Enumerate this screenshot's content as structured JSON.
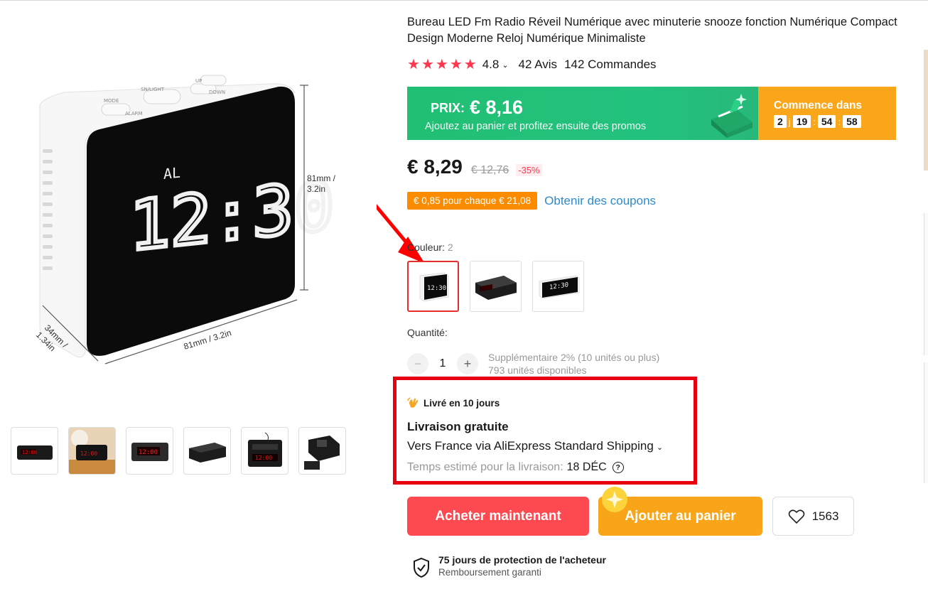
{
  "product": {
    "title": "Bureau LED Fm Radio Réveil Numérique avec minuterie snooze fonction Numérique Compact Design Moderne Reloj Numérique Minimaliste",
    "image_annotations": {
      "clock_al": "AL",
      "clock_time": "12:30",
      "height_dim": "81mm /",
      "height_dim2": "3.2in",
      "width_dim": "81mm / 3.2in",
      "depth_dim": "34mm /",
      "depth_dim2": "1.34in",
      "btn_mode": "MODE",
      "btn_snlight": "SN/LIGHT",
      "btn_up": "UP",
      "btn_down": "DOWN",
      "btn_alarm": "ALARM"
    }
  },
  "rating": {
    "stars": 5,
    "value": "4.8",
    "reviews": "42 Avis",
    "orders": "142 Commandes"
  },
  "promo": {
    "price_label": "PRIX:",
    "price": "€ 8,16",
    "subtitle": "Ajoutez au panier et profitez ensuite des promos",
    "starts_label": "Commence dans",
    "countdown": {
      "days": "2",
      "days_unit": "j",
      "hours": "19",
      "minutes": "54",
      "seconds": "58"
    }
  },
  "price": {
    "current": "€ 8,29",
    "original": "€ 12,76",
    "discount": "-35%"
  },
  "coupon": {
    "badge": "€ 0,85 pour chaque € 21,08",
    "link": "Obtenir des coupons"
  },
  "color": {
    "label": "Couleur:",
    "count": "2",
    "selected_index": 0
  },
  "quantity": {
    "label": "Quantité:",
    "value": "1",
    "extra": "Supplémentaire 2% (10 unités ou plus)",
    "available": "793 unités disponibles"
  },
  "shipping": {
    "delivered": "Livré en 10 jours",
    "free": "Livraison gratuite",
    "via": "Vers France via AliExpress Standard Shipping",
    "eta_label": "Temps estimé pour la livraison:",
    "eta_date": "18 DÉC"
  },
  "actions": {
    "buy_now": "Acheter maintenant",
    "add_to_cart": "Ajouter au panier",
    "wishlist_count": "1563"
  },
  "protection": {
    "title": "75 jours de protection de l'acheteur",
    "subtitle": "Remboursement garanti"
  },
  "colors": {
    "accent_red": "#fd384f",
    "promo_green": "#21bf73",
    "promo_orange": "#f9a61a",
    "highlight_red": "#e80011"
  }
}
